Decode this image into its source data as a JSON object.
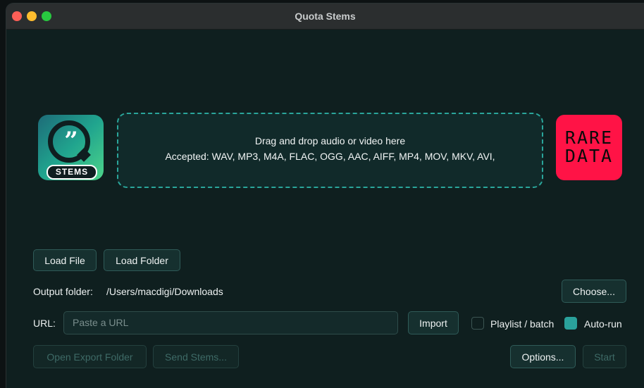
{
  "window": {
    "title": "Quota Stems"
  },
  "logo": {
    "quote_glyph": "”",
    "label": "STEMS"
  },
  "dropzone": {
    "line1": "Drag and drop audio or video here",
    "line2": "Accepted: WAV, MP3, M4A, FLAC, OGG, AAC, AIFF, MP4, MOV, MKV, AVI,"
  },
  "brand_badge": {
    "line1": "RARE",
    "line2": "DATA",
    "color": "#ff1346"
  },
  "buttons": {
    "load_file": "Load File",
    "load_folder": "Load Folder",
    "choose": "Choose...",
    "import": "Import",
    "open_export_folder": "Open Export Folder",
    "send_stems": "Send Stems...",
    "options": "Options...",
    "start": "Start"
  },
  "output": {
    "label": "Output folder:",
    "path": "/Users/macdigi/Downloads"
  },
  "url": {
    "label": "URL:",
    "placeholder": "Paste a URL"
  },
  "options": {
    "playlist_label": "Playlist / batch",
    "playlist_checked": false,
    "autorun_label": "Auto-run",
    "autorun_checked": true
  },
  "colors": {
    "accent": "#2aa19b",
    "background": "#0f1f1f"
  }
}
